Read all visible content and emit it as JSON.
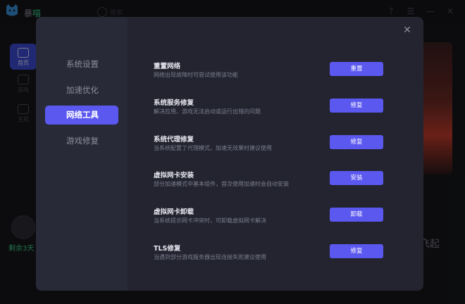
{
  "app": {
    "name_prefix": "暴",
    "name_accent": "喵",
    "search_label": "搜索",
    "nav": [
      {
        "label": "首页",
        "icon": "home-icon",
        "active": true
      },
      {
        "label": "游戏",
        "icon": "monitor-icon",
        "active": false
      },
      {
        "label": "主机",
        "icon": "console-icon",
        "active": false
      }
    ],
    "days_text": "剩余3天",
    "banner_text": "飞起"
  },
  "modal": {
    "sidebar": [
      {
        "label": "系统设置",
        "active": false
      },
      {
        "label": "加速优化",
        "active": false
      },
      {
        "label": "网络工具",
        "active": true
      },
      {
        "label": "游戏修复",
        "active": false
      }
    ],
    "close_icon": "close-icon",
    "items": [
      {
        "title": "重置网络",
        "desc": "网络出现故障时可尝试使用该功能",
        "button": "重置"
      },
      {
        "title": "系统服务修复",
        "desc": "解决应用、游戏无法启动或运行出错的问题",
        "button": "修复"
      },
      {
        "title": "系统代理修复",
        "desc": "当系统配置了代理模式，加速无效果时建议使用",
        "button": "修复"
      },
      {
        "title": "虚拟网卡安装",
        "desc": "部分加速模式中基本组件，首次使用加速时会自动安装",
        "button": "安装"
      },
      {
        "title": "虚拟网卡卸载",
        "desc": "当系统提示网卡冲突时，可卸载虚拟网卡解决",
        "button": "卸载"
      },
      {
        "title": "TLS修复",
        "desc": "当遇到部分游戏服务器出现连接失败建议使用",
        "button": "修复"
      }
    ]
  },
  "colors": {
    "accent": "#5b58f0",
    "nav_active": "#3d4bd6",
    "green": "#3fcf8e"
  }
}
